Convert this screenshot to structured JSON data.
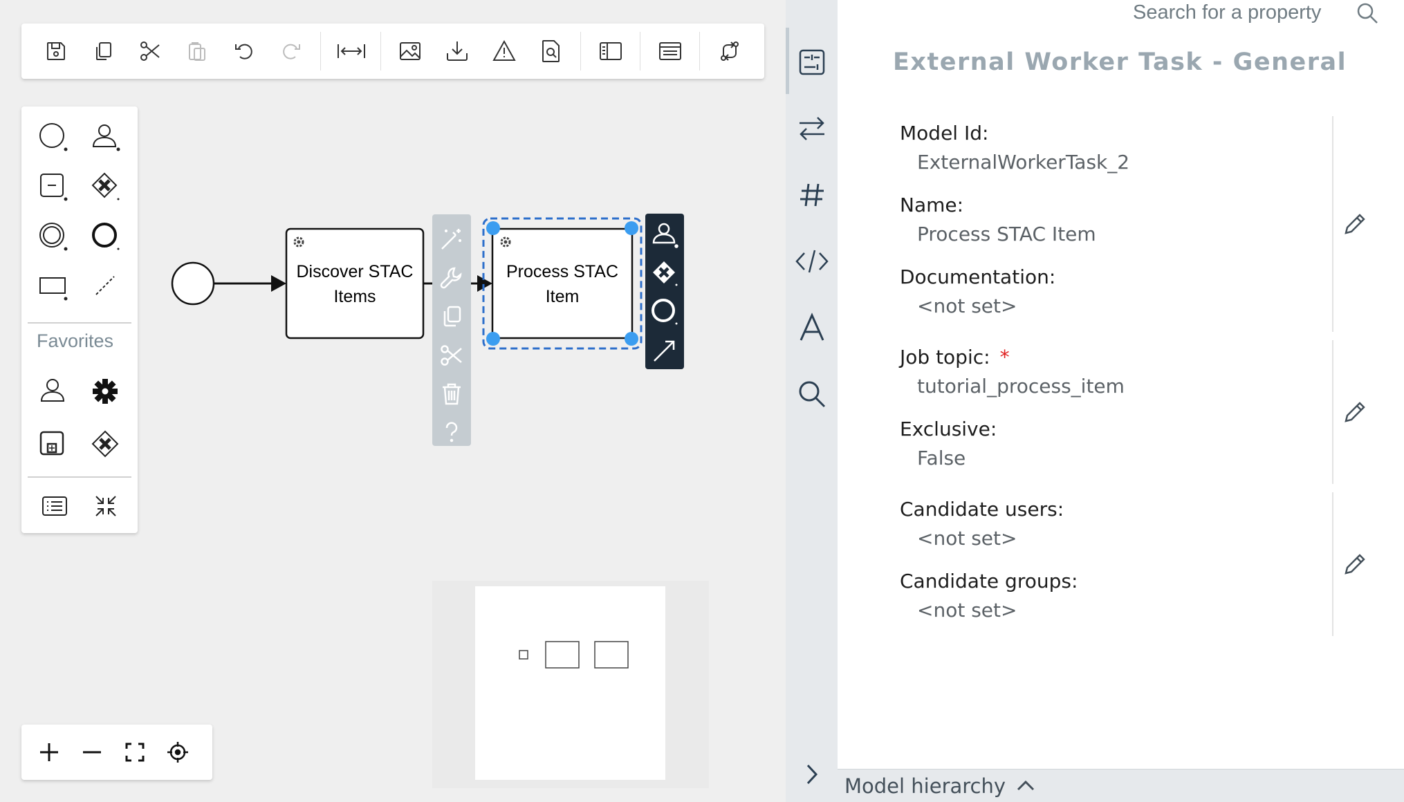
{
  "toolbar": {
    "buttons": [
      "save-model",
      "copy",
      "cut",
      "paste",
      "undo",
      "redo",
      "align-horizontal",
      "export-image",
      "download",
      "validate",
      "preview",
      "toggle-panel",
      "toggle-form",
      "route"
    ]
  },
  "palette": {
    "favorites_label": "Favorites"
  },
  "diagram": {
    "task1": {
      "line1": "Discover STAC",
      "line2": "Items"
    },
    "task2": {
      "line1": "Process STAC",
      "line2": "Item"
    }
  },
  "properties": {
    "search_placeholder": "Search for a property",
    "title": "External Worker Task - General",
    "fields": [
      {
        "label": "Model Id:",
        "value": "ExternalWorkerTask_2"
      },
      {
        "label": "Name:",
        "value": "Process STAC Item"
      },
      {
        "label": "Documentation:",
        "value": "<not set>"
      },
      {
        "label": "Job topic:",
        "value": "tutorial_process_item",
        "required": "*"
      },
      {
        "label": "Exclusive:",
        "value": "False"
      },
      {
        "label": "Candidate users:",
        "value": "<not set>"
      },
      {
        "label": "Candidate groups:",
        "value": "<not set>"
      }
    ]
  },
  "hierarchy": {
    "label": "Model hierarchy"
  },
  "colors": {
    "selection": "#2d6fcb",
    "handle": "#3b9df0",
    "required": "#e02020",
    "dark_pad": "#1c2a38"
  }
}
